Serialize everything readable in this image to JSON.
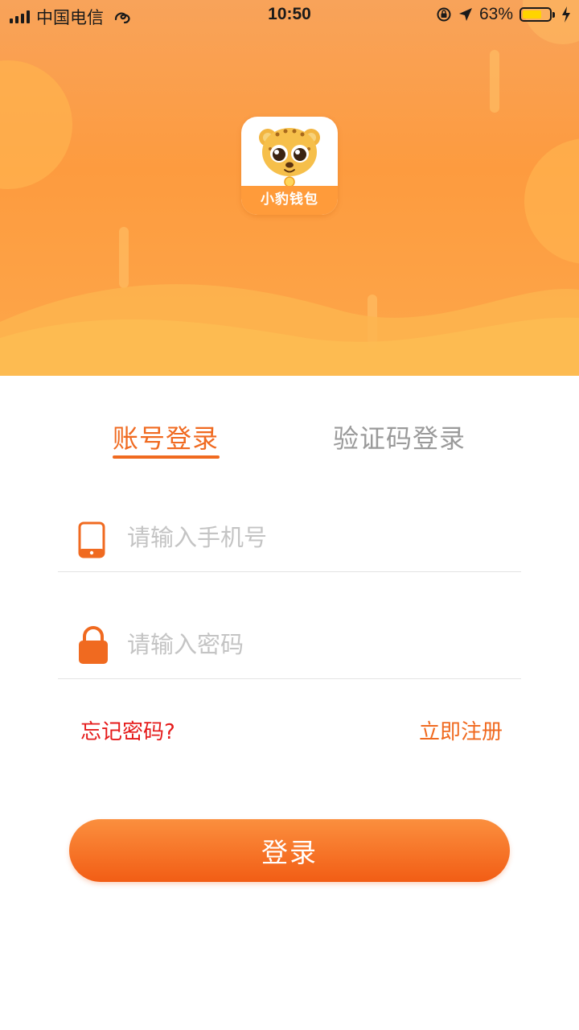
{
  "status_bar": {
    "carrier": "中国电信",
    "time": "10:50",
    "battery_percent": "63%",
    "battery_level": 0.63,
    "icons": [
      "signal-icon",
      "wifi-icon",
      "orientation-lock-icon",
      "location-arrow-icon",
      "battery-icon",
      "charging-bolt-icon"
    ]
  },
  "app": {
    "logo_text": "小豹钱包",
    "logo_icon": "leopard-mascot"
  },
  "tabs": [
    {
      "label": "账号登录",
      "active": true
    },
    {
      "label": "验证码登录",
      "active": false
    }
  ],
  "form": {
    "phone": {
      "placeholder": "请输入手机号",
      "value": "",
      "icon": "phone-icon"
    },
    "password": {
      "placeholder": "请输入密码",
      "value": "",
      "icon": "lock-icon"
    }
  },
  "links": {
    "forgot_password": "忘记密码?",
    "register": "立即注册"
  },
  "login_button": "登录",
  "colors": {
    "accent": "#f06a20",
    "hero_orange": "#fd9b3f",
    "forgot_red": "#e51b1b",
    "battery_yellow": "#ffd400"
  }
}
